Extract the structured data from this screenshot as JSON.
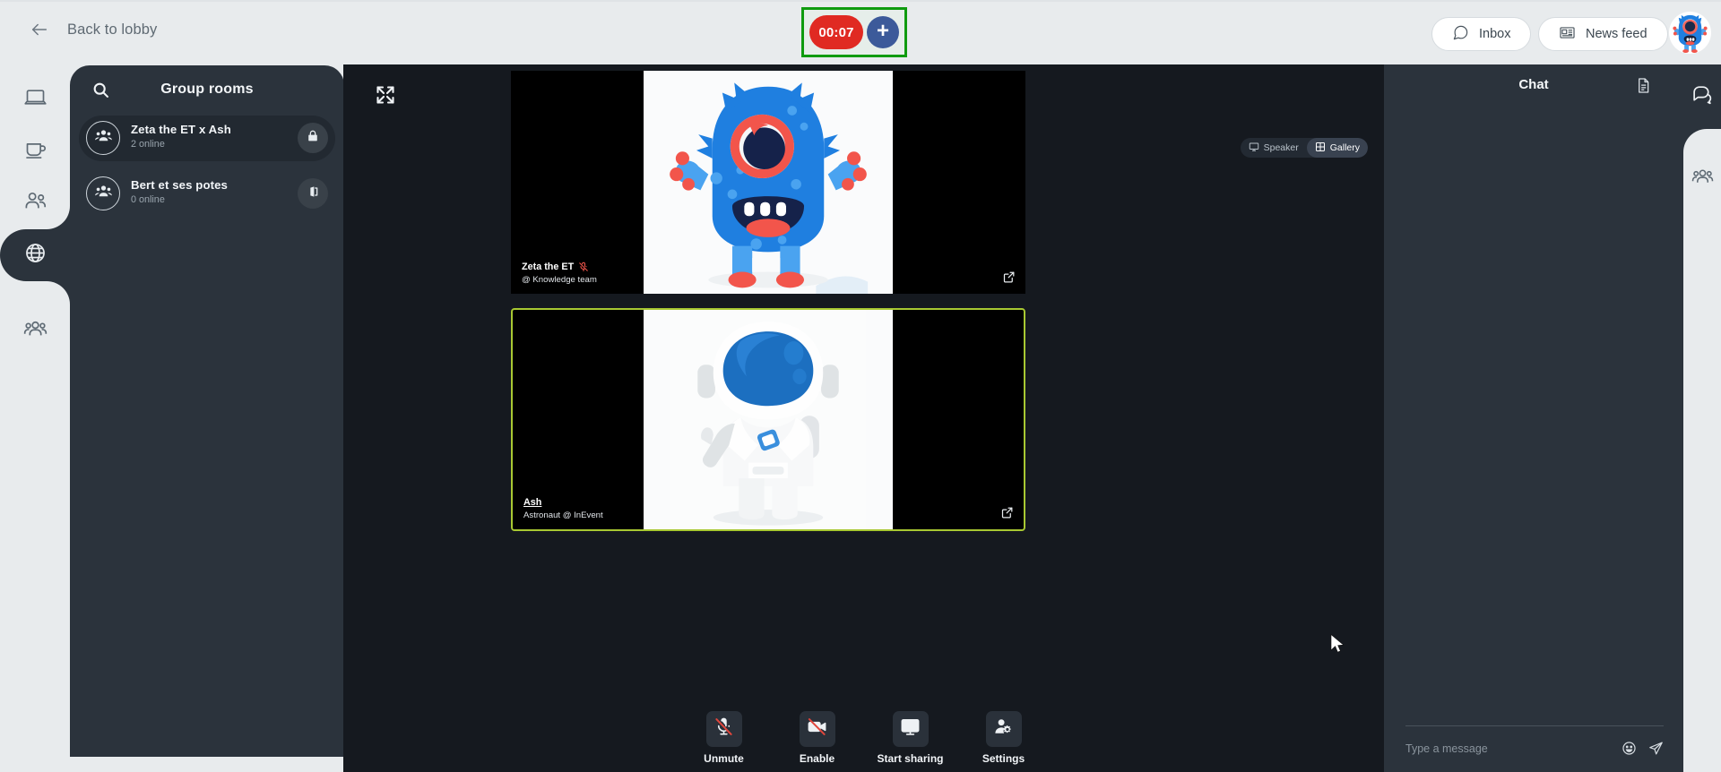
{
  "topbar": {
    "back_label": "Back to lobby",
    "back_icon": "arrow-left-icon",
    "timer_value": "00:07",
    "timer_add_label": "+",
    "timer_highlight_color": "#0f9b0f",
    "timer_pill_color": "#e02a22",
    "timer_add_color": "#3c5a9a",
    "inbox_label": "Inbox",
    "inbox_icon": "chat-bubble-icon",
    "newsfeed_label": "News feed",
    "newsfeed_icon": "newspaper-icon",
    "avatar_icon": "blue-monster-avatar-icon"
  },
  "left_rail": {
    "items": [
      {
        "name": "laptop-icon",
        "active": false
      },
      {
        "name": "coffee-cup-icon",
        "active": false
      },
      {
        "name": "two-people-icon",
        "active": false
      },
      {
        "name": "globe-icon",
        "active": true
      },
      {
        "name": "people-group-icon",
        "active": false
      }
    ]
  },
  "rooms": {
    "title": "Group rooms",
    "search_icon": "search-icon",
    "items": [
      {
        "name": "Zeta the ET x Ash",
        "status": "2 online",
        "action_icon": "lock-icon",
        "avatar_icon": "people-group-icon",
        "selected": true
      },
      {
        "name": "Bert et ses potes",
        "status": "0 online",
        "action_icon": "exit-door-icon",
        "avatar_icon": "people-group-icon",
        "selected": false
      }
    ]
  },
  "stage": {
    "expand_icon": "expand-arrows-icon",
    "view_toggle": {
      "speaker_label": "Speaker",
      "speaker_icon": "monitor-icon",
      "gallery_label": "Gallery",
      "gallery_icon": "grid-icon",
      "active": "Gallery"
    },
    "tiles": [
      {
        "name": "Zeta the ET",
        "subtitle": "@ Knowledge team",
        "muted": true,
        "mic_icon": "mic-off-icon",
        "popout_icon": "popout-icon",
        "media": "blue-monster-illustration",
        "speaking": false,
        "name_underlined": false
      },
      {
        "name": "Ash",
        "subtitle": "Astronaut @ InEvent",
        "muted": false,
        "mic_icon": "",
        "popout_icon": "popout-icon",
        "media": "astronaut-illustration",
        "speaking": true,
        "name_underlined": true,
        "speaking_border_color": "#a8c832"
      }
    ],
    "controls": [
      {
        "label": "Unmute",
        "icon": "mic-off-icon"
      },
      {
        "label": "Enable",
        "icon": "camera-off-icon"
      },
      {
        "label": "Start sharing",
        "icon": "monitor-icon"
      },
      {
        "label": "Settings",
        "icon": "person-gear-icon"
      }
    ]
  },
  "chat": {
    "title": "Chat",
    "doc_icon": "document-icon",
    "input_placeholder": "Type a message",
    "input_value": "",
    "emoji_icon": "emoji-icon",
    "send_icon": "send-plane-icon",
    "messages": []
  },
  "right_rail": {
    "items": [
      {
        "name": "chat-bubbles-icon",
        "active": true
      },
      {
        "name": "people-group-icon",
        "active": false
      }
    ]
  },
  "cursor": {
    "icon": "mouse-pointer-icon"
  }
}
